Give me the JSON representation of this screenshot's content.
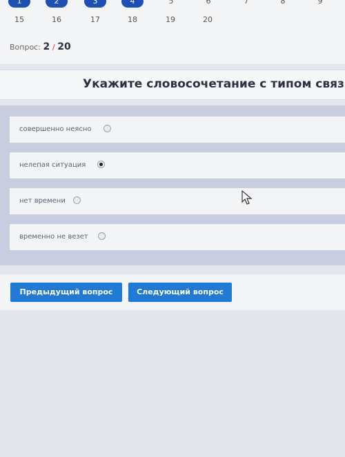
{
  "nav": {
    "row1": [
      "1",
      "2",
      "3",
      "4",
      "5",
      "6",
      "7",
      "8",
      "9"
    ],
    "row2": [
      "15",
      "16",
      "17",
      "18",
      "19",
      "20"
    ]
  },
  "counter": {
    "prefix": "Вопрос:",
    "current": "2",
    "separator": "/",
    "total": "20"
  },
  "question": "Укажите словосочетание с типом связ",
  "answers": [
    {
      "label": "совершенно неясно",
      "selected": false
    },
    {
      "label": "нелепая ситуация",
      "selected": true
    },
    {
      "label": "нет времени",
      "selected": false
    },
    {
      "label": "временно не везет",
      "selected": false
    }
  ],
  "buttons": {
    "prev": "Предыдущий вопрос",
    "next": "Следующий вопрос"
  },
  "colors": {
    "accent": "#1f7ad6",
    "answered_nav": "#1e4fb4",
    "panel": "#c8cde0"
  }
}
